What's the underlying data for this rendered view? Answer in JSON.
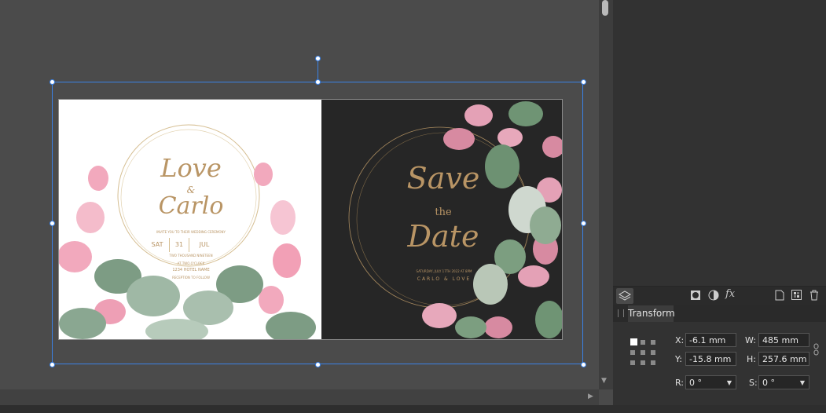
{
  "document": {
    "left_card": {
      "title_line1": "Love",
      "ampersand": "&",
      "title_line2": "Carlo",
      "invite_line": "INVITE YOU TO THEIR WEDDING CEREMONY",
      "day": "SAT",
      "date": "31",
      "month": "JUL",
      "year_line": "TWO THOUSAND NINETEEN",
      "time_line": "AT TWO O'CLOCK",
      "venue": "1234 HOTEL NAME",
      "reception": "RECEPTION TO FOLLOW"
    },
    "right_card": {
      "title_line1": "Save",
      "connector": "the",
      "title_line2": "Date",
      "date_line": "SATURDAY, JULY 17TH 2022 AT 8PM",
      "names": "CARLO & LOVE"
    }
  },
  "panel": {
    "active_tab": "Transform",
    "fields": {
      "x_label": "X:",
      "x_value": "-6.1 mm",
      "y_label": "Y:",
      "y_value": "-15.8 mm",
      "w_label": "W:",
      "w_value": "485 mm",
      "h_label": "H:",
      "h_value": "257.6 mm",
      "r_label": "R:",
      "r_value": "0 °",
      "s_label": "S:",
      "s_value": "0 °"
    },
    "toolbar_icons": [
      "layers-icon",
      "mask-icon",
      "adjustment-icon",
      "fx-icon",
      "new-document-icon",
      "pattern-icon",
      "trash-icon"
    ]
  },
  "colors": {
    "selection": "#3b82e6",
    "gold_text": "#b99565",
    "dark_card": "#262626"
  }
}
